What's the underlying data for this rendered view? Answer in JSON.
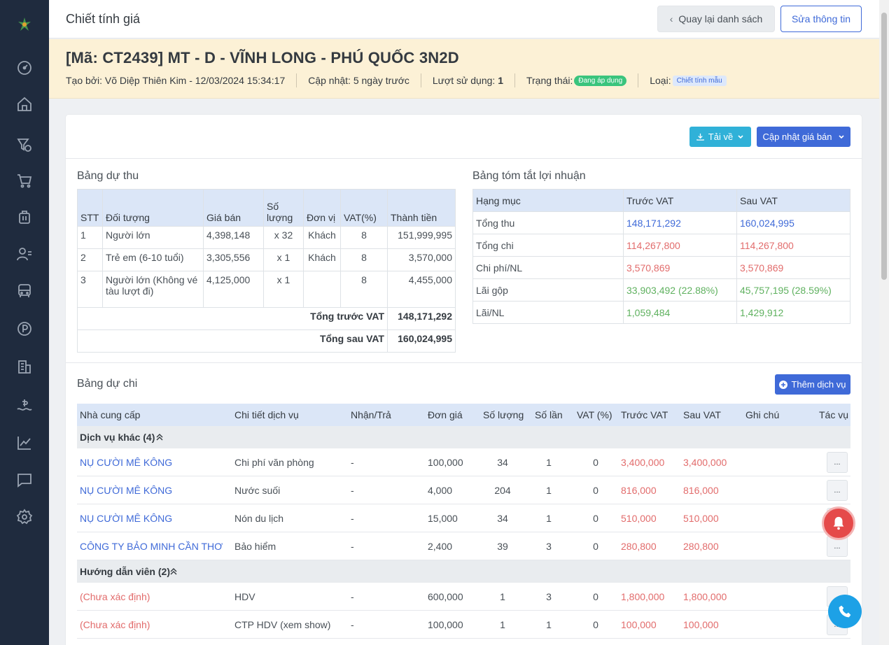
{
  "header": {
    "title": "Chiết tính giá",
    "back_label": "Quay lại danh sách",
    "edit_label": "Sửa thông tin"
  },
  "banner": {
    "code_title": "[Mã: CT2439] MT - D - VĨNH LONG - PHÚ QUỐC 3N2D",
    "created_label": "Tạo bởi:",
    "created_value": "Võ Diệp Thiên Kim - 12/03/2024 15:34:17",
    "updated_label": "Cập nhật:",
    "updated_value": "5 ngày trước",
    "usage_label": "Lượt sử dụng:",
    "usage_value": "1",
    "status_label": "Trạng thái:",
    "status_value": "Đang áp dụng",
    "type_label": "Loại:",
    "type_value": "Chiết tính mẫu"
  },
  "actions": {
    "download_label": "Tải về",
    "update_price_label": "Cập nhật giá bán",
    "add_service_label": "Thêm dịch vụ"
  },
  "revenue": {
    "title": "Bảng dự thu",
    "headers": {
      "stt": "STT",
      "target": "Đối tượng",
      "price": "Giá bán",
      "qty": "Số lượng",
      "unit": "Đơn vị",
      "vat": "VAT(%)",
      "total": "Thành tiền"
    },
    "rows": [
      {
        "stt": "1",
        "target": "Người lớn",
        "price": "4,398,148",
        "qty": "x 32",
        "unit": "Khách",
        "vat": "8",
        "total": "151,999,995"
      },
      {
        "stt": "2",
        "target": "Trẻ em (6-10 tuổi)",
        "price": "3,305,556",
        "qty": "x 1",
        "unit": "Khách",
        "vat": "8",
        "total": "3,570,000"
      },
      {
        "stt": "3",
        "target": "Người lớn (Không vé tàu lượt đi)",
        "price": "4,125,000",
        "qty": "x 1",
        "unit": "",
        "vat": "8",
        "total": "4,455,000"
      }
    ],
    "total_before_label": "Tổng trước VAT",
    "total_before": "148,171,292",
    "total_after_label": "Tổng sau VAT",
    "total_after": "160,024,995"
  },
  "profit": {
    "title": "Bảng tóm tắt lợi nhuận",
    "headers": {
      "item": "Hạng mục",
      "before": "Trước VAT",
      "after": "Sau VAT"
    },
    "rows": [
      {
        "item": "Tổng thu",
        "before": "148,171,292",
        "after": "160,024,995",
        "color": "#3f6ad8"
      },
      {
        "item": "Tổng chi",
        "before": "114,267,800",
        "after": "114,267,800",
        "color": "#e26c6c"
      },
      {
        "item": "Chi phí/NL",
        "before": "3,570,869",
        "after": "3,570,869",
        "color": "#e26c6c"
      },
      {
        "item": "Lãi gộp",
        "before": "33,903,492 (22.88%)",
        "after": "45,757,195 (28.59%)",
        "color": "#5fb15f"
      },
      {
        "item": "Lãi/NL",
        "before": "1,059,484",
        "after": "1,429,912",
        "color": "#5fb15f"
      }
    ]
  },
  "expense": {
    "title": "Bảng dự chi",
    "headers": {
      "supplier": "Nhà cung cấp",
      "detail": "Chi tiết dịch vụ",
      "recv": "Nhận/Trả",
      "unit_price": "Đơn giá",
      "qty": "Số lượng",
      "times": "Số lần",
      "vat": "VAT (%)",
      "before": "Trước VAT",
      "after": "Sau VAT",
      "note": "Ghi chú",
      "action": "Tác vụ"
    },
    "groups": [
      {
        "name": "Dịch vụ khác (4)",
        "rows": [
          {
            "supplier": "NỤ CƯỜI MÊ KÔNG",
            "supplier_color": "#3f6ad8",
            "detail": "Chi phí văn phòng",
            "recv": "-",
            "unit_price": "100,000",
            "qty": "34",
            "times": "1",
            "vat": "0",
            "before": "3,400,000",
            "after": "3,400,000",
            "action": "..."
          },
          {
            "supplier": "NỤ CƯỜI MÊ KÔNG",
            "supplier_color": "#3f6ad8",
            "detail": "Nước suối",
            "recv": "-",
            "unit_price": "4,000",
            "qty": "204",
            "times": "1",
            "vat": "0",
            "before": "816,000",
            "after": "816,000",
            "action": "..."
          },
          {
            "supplier": "NỤ CƯỜI MÊ KÔNG",
            "supplier_color": "#3f6ad8",
            "detail": "Nón du lịch",
            "recv": "-",
            "unit_price": "15,000",
            "qty": "34",
            "times": "1",
            "vat": "0",
            "before": "510,000",
            "after": "510,000",
            "action": "..."
          },
          {
            "supplier": "CÔNG TY BẢO MINH CẦN THƠ",
            "supplier_color": "#3f6ad8",
            "detail": "Bảo hiểm",
            "recv": "-",
            "unit_price": "2,400",
            "qty": "39",
            "times": "3",
            "vat": "0",
            "before": "280,800",
            "after": "280,800",
            "action": "..."
          }
        ]
      },
      {
        "name": "Hướng dẫn viên (2)",
        "rows": [
          {
            "supplier": "(Chưa xác định)",
            "supplier_color": "#e26c6c",
            "detail": "HDV",
            "recv": "-",
            "unit_price": "600,000",
            "qty": "1",
            "times": "3",
            "vat": "0",
            "before": "1,800,000",
            "after": "1,800,000",
            "action": "..."
          },
          {
            "supplier": "(Chưa xác định)",
            "supplier_color": "#e26c6c",
            "detail": "CTP HDV (xem show)",
            "recv": "-",
            "unit_price": "100,000",
            "qty": "1",
            "times": "1",
            "vat": "0",
            "before": "100,000",
            "after": "100,000",
            "action": "..."
          }
        ]
      }
    ]
  },
  "colors": {
    "sidebar": "#1f2b3e",
    "accent": "#3f6ad8",
    "banner": "#fcf1d6",
    "negative": "#e26c6c",
    "positive": "#5fb15f"
  }
}
